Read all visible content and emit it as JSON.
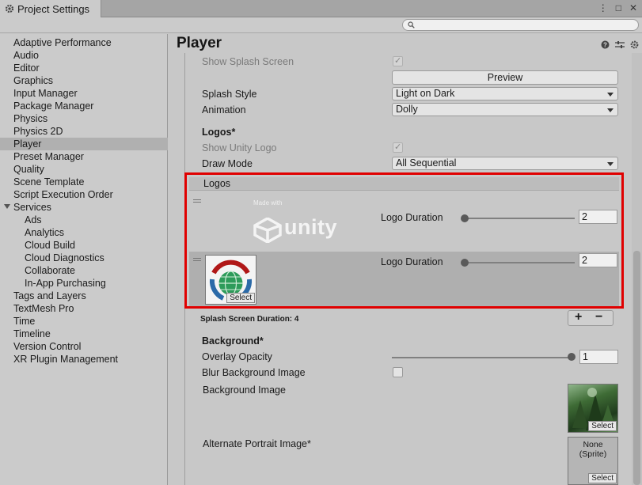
{
  "window": {
    "tab_title": "Project Settings",
    "controls": [
      "⋮",
      "□",
      "✕"
    ]
  },
  "search": {
    "placeholder": "",
    "value": ""
  },
  "sidebar": {
    "items": [
      {
        "label": "Adaptive Performance"
      },
      {
        "label": "Audio"
      },
      {
        "label": "Editor"
      },
      {
        "label": "Graphics"
      },
      {
        "label": "Input Manager"
      },
      {
        "label": "Package Manager"
      },
      {
        "label": "Physics"
      },
      {
        "label": "Physics 2D"
      },
      {
        "label": "Player",
        "selected": true
      },
      {
        "label": "Preset Manager"
      },
      {
        "label": "Quality"
      },
      {
        "label": "Scene Template"
      },
      {
        "label": "Script Execution Order"
      },
      {
        "label": "Services",
        "expanded": true
      },
      {
        "label": "Ads",
        "child": true
      },
      {
        "label": "Analytics",
        "child": true
      },
      {
        "label": "Cloud Build",
        "child": true
      },
      {
        "label": "Cloud Diagnostics",
        "child": true
      },
      {
        "label": "Collaborate",
        "child": true
      },
      {
        "label": "In-App Purchasing",
        "child": true
      },
      {
        "label": "Tags and Layers"
      },
      {
        "label": "TextMesh Pro"
      },
      {
        "label": "Time"
      },
      {
        "label": "Timeline"
      },
      {
        "label": "Version Control"
      },
      {
        "label": "XR Plugin Management"
      }
    ]
  },
  "main": {
    "title": "Player",
    "show_splash_screen_label": "Show Splash Screen",
    "preview_button": "Preview",
    "splash_style_label": "Splash Style",
    "splash_style_value": "Light on Dark",
    "animation_label": "Animation",
    "animation_value": "Dolly",
    "logos_section": "Logos*",
    "show_unity_logo_label": "Show Unity Logo",
    "draw_mode_label": "Draw Mode",
    "draw_mode_value": "All Sequential",
    "logos_list_header": "Logos",
    "made_with_text": "Made with",
    "unity_text": "unity",
    "logo_duration_label": "Logo Duration",
    "logo1_duration": "2",
    "logo2_duration": "2",
    "select_label": "Select",
    "splash_duration_text": "Splash Screen Duration: 4",
    "add_button": "+",
    "remove_button": "−",
    "background_section": "Background*",
    "overlay_opacity_label": "Overlay Opacity",
    "overlay_opacity_value": "1",
    "blur_bg_label": "Blur Background Image",
    "bg_image_label": "Background Image",
    "alt_portrait_label": "Alternate Portrait Image*",
    "none_sprite_line1": "None",
    "none_sprite_line2": "(Sprite)"
  },
  "colors": {
    "highlight_border": "#e00000",
    "selected_row": "#b0b0b0"
  }
}
